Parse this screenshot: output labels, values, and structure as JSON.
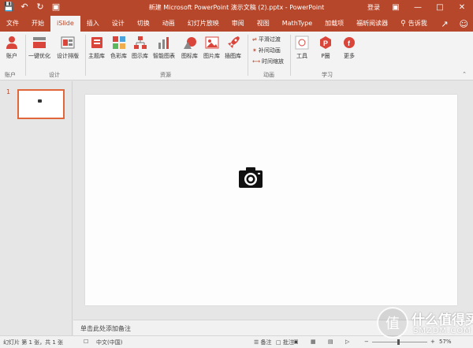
{
  "titlebar": {
    "title": "新建 Microsoft PowerPoint 演示文稿 (2).pptx  -  PowerPoint",
    "login": "登录",
    "qat_icons": [
      "save-icon",
      "undo-icon",
      "redo-icon",
      "present-icon"
    ],
    "win_icons": [
      "ribbon-display-icon",
      "minimize-icon",
      "maximize-icon",
      "close-icon"
    ]
  },
  "tabs": [
    {
      "label": "文件",
      "active": false
    },
    {
      "label": "开始",
      "active": false
    },
    {
      "label": "iSlide",
      "active": true
    },
    {
      "label": "插入",
      "active": false
    },
    {
      "label": "设计",
      "active": false
    },
    {
      "label": "切换",
      "active": false
    },
    {
      "label": "动画",
      "active": false
    },
    {
      "label": "幻灯片放映",
      "active": false
    },
    {
      "label": "审阅",
      "active": false
    },
    {
      "label": "视图",
      "active": false
    },
    {
      "label": "MathType",
      "active": false
    },
    {
      "label": "加载项",
      "active": false
    },
    {
      "label": "福昕阅读器",
      "active": false
    }
  ],
  "tellme": "告诉我",
  "ribbon": {
    "buttons": {
      "account": "账户",
      "optimize": "一键优化",
      "layout": "设计排版",
      "theme": "主题库",
      "color": "色彩库",
      "diagram": "图示库",
      "smartchart": "智能图表",
      "iconlib": "图标库",
      "piclib": "图片库",
      "illus": "插图库",
      "tools": "工具",
      "pcoin": "P圈",
      "more": "更多"
    },
    "anim_items": [
      "平滑过渡",
      "补间动画",
      "时间缩放"
    ],
    "groups": {
      "account": "账户",
      "design": "设计",
      "resource": "资源",
      "animation": "动画",
      "learn": "学习"
    }
  },
  "slides_pane": {
    "slide_number": "1"
  },
  "notes_placeholder": "单击此处添加备注",
  "statusbar": {
    "slide_info": "幻灯片 第 1 张，共 1 张",
    "language": "中文(中国)",
    "notes": "备注",
    "comments": "批注",
    "zoom": "57%"
  },
  "watermark": {
    "logo_char": "值",
    "brand": "什么值得买",
    "site": "SMZDM.COM"
  },
  "colors": {
    "accent": "#b7472a",
    "ribbon_bg": "#f3f3f3",
    "workspace_bg": "#e6e6e6"
  }
}
